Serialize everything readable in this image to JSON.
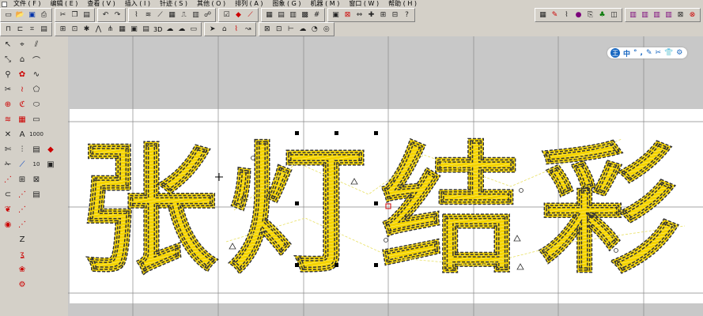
{
  "menu": {
    "items": [
      "文件 ( F )",
      "编辑 ( E )",
      "查看 ( V )",
      "插入 ( I )",
      "针迹 ( S )",
      "其他 ( O )",
      "排列 ( A )",
      "图象 ( G )",
      "机器 ( M )",
      "窗口 ( W )",
      "帮助 ( H )"
    ]
  },
  "toolbar": {
    "label_3d": "3D",
    "label_1000": "1000",
    "label_10": "10",
    "label_z": "Z"
  },
  "floatbar": {
    "logo": "王",
    "items": [
      "中",
      "°",
      ",",
      "✎",
      "✂",
      "👕",
      "⚙"
    ]
  },
  "design": {
    "text": "张灯结彩",
    "characters": [
      "张",
      "灯",
      "结",
      "彩"
    ],
    "fill_color": "#f5d400",
    "stroke_color": "#333333",
    "stitch_color": "#fff7b0",
    "canvas_gray": "#c8c8c8",
    "hoop_color": "#ffffff",
    "grid_color": "#888888"
  }
}
